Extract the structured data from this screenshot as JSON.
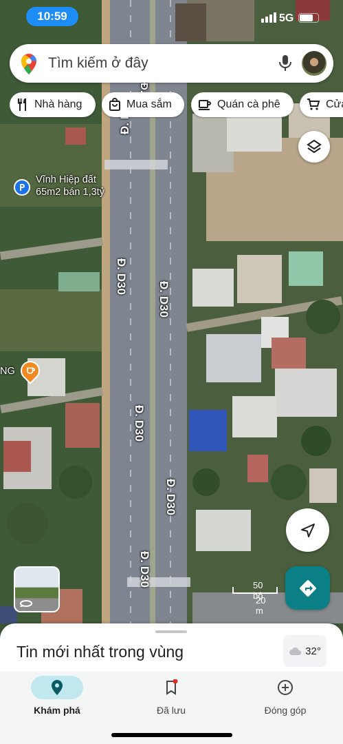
{
  "status_bar": {
    "time": "10:59",
    "network": "5G",
    "battery_level": 0.75
  },
  "search": {
    "placeholder": "Tìm kiếm ở đây",
    "icons": [
      "maps-pin-icon",
      "microphone-icon",
      "avatar"
    ]
  },
  "chips": [
    {
      "label": "Nhà hàng",
      "icon": "restaurant-icon"
    },
    {
      "label": "Mua sắm",
      "icon": "shopping-bag-icon"
    },
    {
      "label": "Quán cà phê",
      "icon": "coffee-icon"
    },
    {
      "label": "Cửa",
      "icon": "cart-icon"
    }
  ],
  "map": {
    "road_labels": [
      "Đ. D30",
      "Đ. D30",
      "Đ. D30",
      "Đ. D30",
      "Đ. D30",
      "Đ. D30",
      "Đ. D30"
    ],
    "poi_parking": {
      "line1": "Vĩnh Hiệp đất",
      "line2": "65m2 bán 1,3tỷ",
      "icon": "parking-icon"
    },
    "poi_cafe": {
      "label": "NG",
      "icon": "coffee-icon"
    },
    "scale": {
      "feet": "50 bộ",
      "meters": "20 m"
    },
    "accent_color": "#0b7f86"
  },
  "sheet": {
    "title": "Tin mới nhất trong vùng",
    "weather": "32°"
  },
  "nav": [
    {
      "label": "Khám phá",
      "icon": "explore-pin-icon",
      "active": true
    },
    {
      "label": "Đã lưu",
      "icon": "bookmark-icon",
      "badge": true
    },
    {
      "label": "Đóng góp",
      "icon": "add-circle-icon"
    }
  ]
}
